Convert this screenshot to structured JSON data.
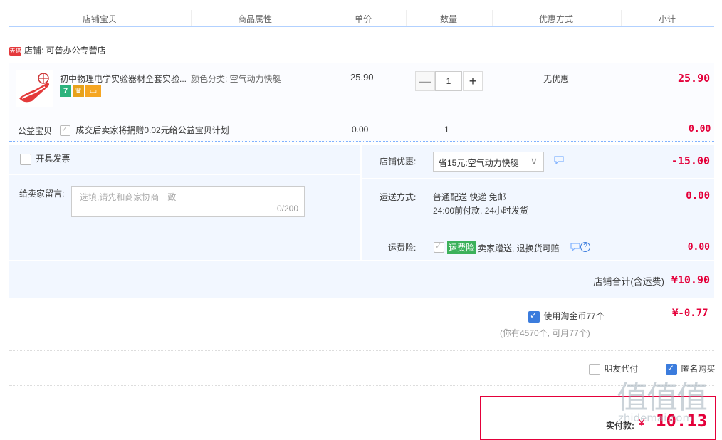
{
  "headers": {
    "col1": "店铺宝贝",
    "col2": "商品属性",
    "col3": "单价",
    "col4": "数量",
    "col5": "优惠方式",
    "col6": "小计"
  },
  "shop": {
    "tmall_badge": "天猫",
    "label": "店铺: 可普办公专营店"
  },
  "item": {
    "title": "初中物理电学实验器材全套实验...",
    "attr": "颜色分类: 空气动力快艇",
    "price": "25.90",
    "qty": "1",
    "minus": "—",
    "plus": "+",
    "discount": "无优惠",
    "subtotal": "25.90",
    "badges": [
      {
        "t": "7",
        "c": "#2db37d"
      },
      {
        "t": "♛",
        "c": "#e7a21b"
      },
      {
        "t": "▭",
        "c": "#f5a623"
      }
    ]
  },
  "charity": {
    "label": "公益宝贝",
    "text": "成交后卖家将捐赠0.02元给公益宝贝计划",
    "price": "0.00",
    "qty": "1",
    "subtotal": "0.00"
  },
  "invoice": {
    "label": "开具发票"
  },
  "message": {
    "label": "给卖家留言:",
    "placeholder": "选填,请先和商家协商一致",
    "counter": "0/200"
  },
  "shop_discount": {
    "label": "店铺优惠:",
    "selected": "省15元:空气动力快艇",
    "chevron": "∨",
    "amount": "-15.00"
  },
  "shipping": {
    "label": "运送方式:",
    "line1": "普通配送 快递 免邮",
    "line2": "24:00前付款, 24小时发货",
    "amount": "0.00"
  },
  "insurance": {
    "label": "运费险:",
    "badge": "运费险",
    "text": "卖家赠送, 退换货可赔",
    "help": "?",
    "amount": "0.00"
  },
  "shop_total": {
    "label": "店铺合计(含运费)",
    "amount": "¥10.90"
  },
  "coins": {
    "label": "使用淘金币77个",
    "amount": "¥-0.77",
    "note": "(你有4570个, 可用77个)"
  },
  "options": {
    "friend_pay": "朋友代付",
    "anonymous": "匿名购买"
  },
  "final": {
    "label": "实付款:",
    "currency": "¥",
    "amount": "10.13"
  },
  "watermark": {
    "big": "值值值",
    "small": "zhidemai.com"
  }
}
